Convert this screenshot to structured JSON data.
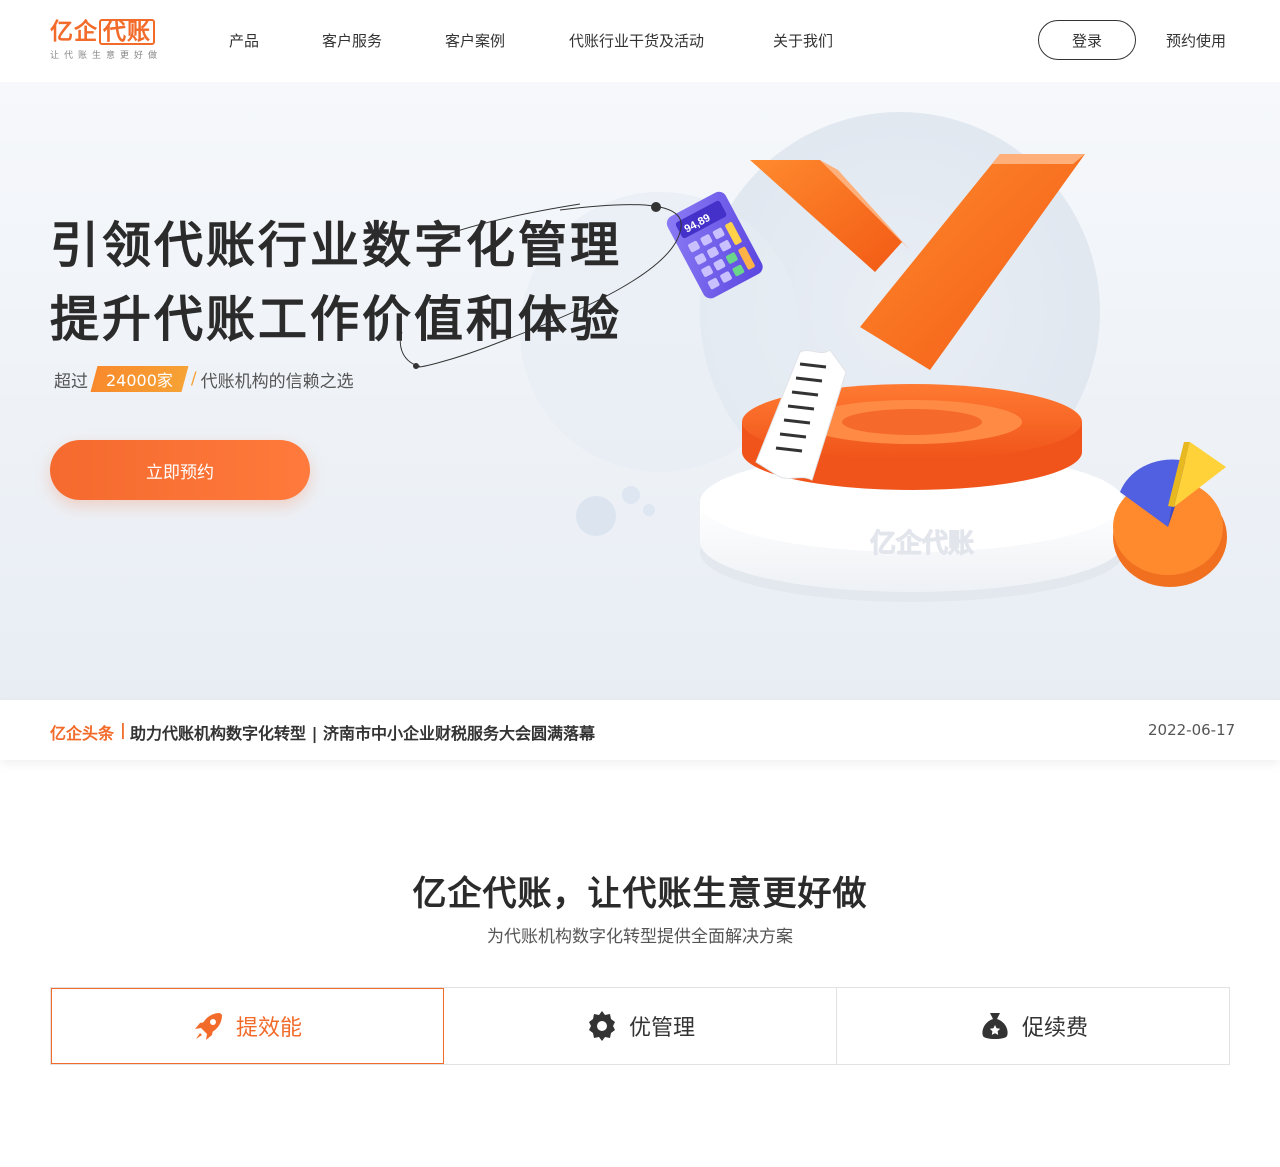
{
  "header": {
    "logo_text_a": "亿企",
    "logo_text_b": "代账",
    "logo_tagline": "让代账生意更好做",
    "nav": [
      {
        "label": "产品"
      },
      {
        "label": "客户服务"
      },
      {
        "label": "客户案例"
      },
      {
        "label": "代账行业干货及活动"
      },
      {
        "label": "关于我们"
      }
    ],
    "login_label": "登录",
    "reserve_label": "预约使用"
  },
  "hero": {
    "title_line1": "引领代账行业数字化管理",
    "title_line2": "提升代账工作价值和体验",
    "sub_prefix": "超过",
    "sub_badge": "24000家",
    "sub_suffix": "代账机构的信赖之选",
    "cta_label": "立即预约",
    "calculator_display": "94,89",
    "platform_watermark": "亿企代账"
  },
  "news": {
    "tag": "亿企头条",
    "separator": "|",
    "headline": "助力代账机构数字化转型 | 济南市中小企业财税服务大会圆满落幕",
    "date": "2022-06-17"
  },
  "section": {
    "title": "亿企代账，让代账生意更好做",
    "subtitle": "为代账机构数字化转型提供全面解决方案",
    "tabs": [
      {
        "label": "提效能",
        "icon": "rocket-icon",
        "active": true
      },
      {
        "label": "优管理",
        "icon": "gear-icon",
        "active": false
      },
      {
        "label": "促续费",
        "icon": "money-bag-icon",
        "active": false
      }
    ]
  },
  "colors": {
    "brand": "#f26b2a",
    "text": "#333333",
    "hero_bg": "#eef2f7"
  }
}
